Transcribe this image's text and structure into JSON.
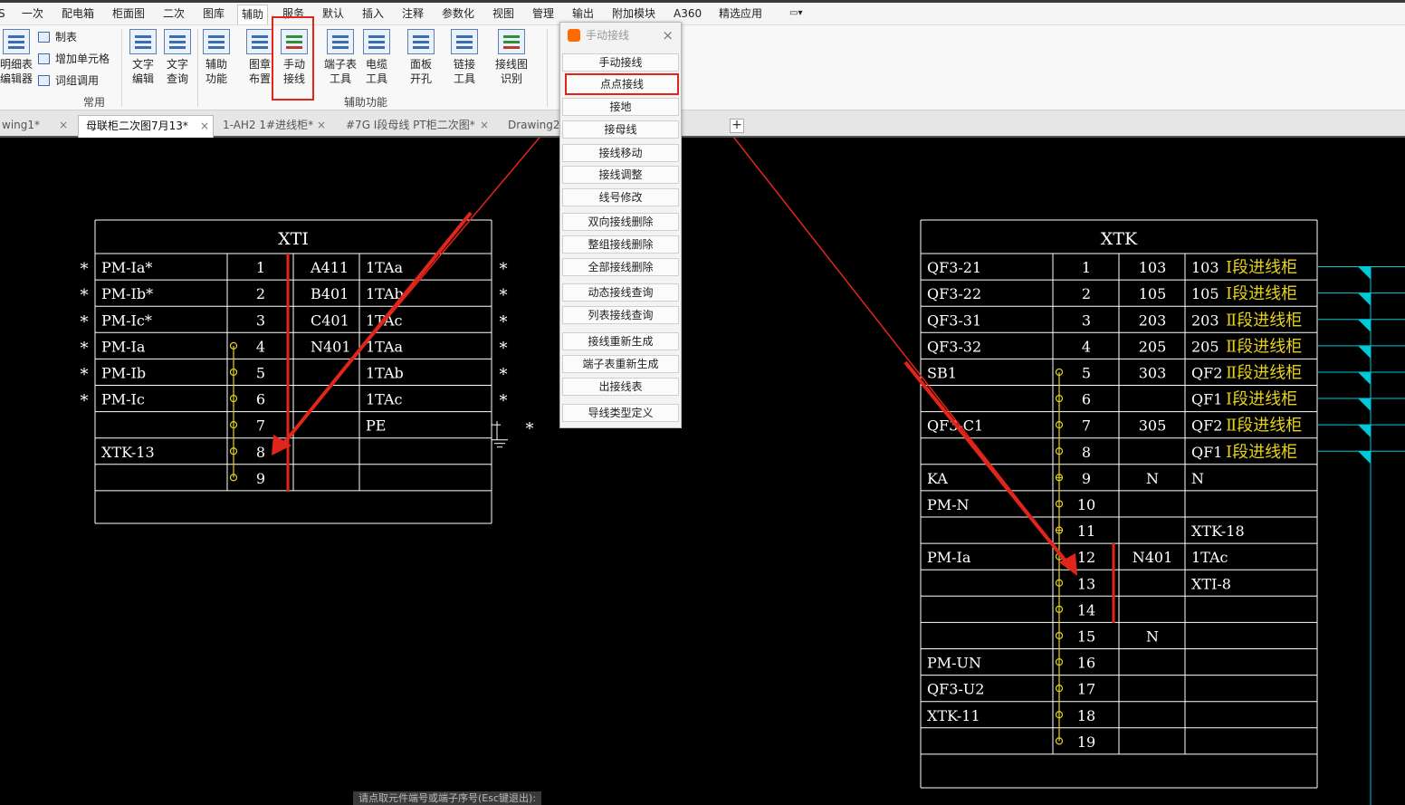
{
  "menu": {
    "tabs": [
      "S",
      "一次",
      "配电箱",
      "柜面图",
      "二次",
      "图库",
      "辅助",
      "服务",
      "默认",
      "插入",
      "注释",
      "参数化",
      "视图",
      "管理",
      "输出",
      "附加模块",
      "A360",
      "精选应用"
    ],
    "active": "辅助",
    "extra": "▭▾"
  },
  "ribbon": {
    "left_items": [
      "制表",
      "增加单元格",
      "词组调用"
    ],
    "big_left": [
      "明细表\n编辑器"
    ],
    "buttons": [
      {
        "label": "文字\n编辑"
      },
      {
        "label": "文字\n查询"
      },
      {
        "label": "辅助\n功能"
      },
      {
        "label": "图章\n布置"
      },
      {
        "label": "手动\n接线"
      },
      {
        "label": "端子表\n工具"
      },
      {
        "label": "电缆\n工具"
      },
      {
        "label": "面板\n开孔"
      },
      {
        "label": "链接\n工具"
      },
      {
        "label": "接线图\n识别"
      }
    ],
    "groups": [
      "常用",
      "辅助功能"
    ]
  },
  "doc_tabs": [
    "wing1*",
    "母联柜二次图7月13*",
    "1-AH2 1#进线柜*",
    "#7G I段母线 PT柜二次图*",
    "Drawing2*"
  ],
  "doc_tab_active": "母联柜二次图7月13*",
  "palette": {
    "title": "手动接线",
    "close": "×",
    "items": [
      "手动接线",
      "点点接线",
      "接地",
      "接母线",
      "接线移动",
      "接线调整",
      "线号修改",
      "双向接线删除",
      "整组接线删除",
      "全部接线删除",
      "动态接线查询",
      "列表接线查询",
      "接线重新生成",
      "端子表重新生成",
      "出接线表",
      "导线类型定义"
    ],
    "highlight": "点点接线"
  },
  "status": "请点取元件端号或端子序号(Esc键退出):",
  "colors": {
    "red": "#e1251b",
    "yellow": "#e6d21a",
    "cyan": "#00c8d8",
    "white": "#ffffff"
  },
  "xti": {
    "title": "XTI",
    "rows": [
      {
        "left": "PM-Ia*",
        "num": "1",
        "c3": "A411",
        "c4": "1TAa",
        "star": "*",
        "lstar": "*",
        "node": ""
      },
      {
        "left": "PM-Ib*",
        "num": "2",
        "c3": "B401",
        "c4": "1TAb",
        "star": "*",
        "lstar": "*",
        "node": ""
      },
      {
        "left": "PM-Ic*",
        "num": "3",
        "c3": "C401",
        "c4": "1TAc",
        "star": "*",
        "lstar": "*",
        "node": ""
      },
      {
        "left": "PM-Ia",
        "num": "4",
        "c3": "N401",
        "c4": "1TAa",
        "star": "*",
        "lstar": "*",
        "node": "o"
      },
      {
        "left": "PM-Ib",
        "num": "5",
        "c3": "",
        "c4": "1TAb",
        "star": "*",
        "lstar": "*",
        "node": "o"
      },
      {
        "left": "PM-Ic",
        "num": "6",
        "c3": "",
        "c4": "1TAc",
        "star": "*",
        "lstar": "*",
        "node": "o"
      },
      {
        "left": "",
        "num": "7",
        "c3": "",
        "c4": "PE",
        "star": "",
        "lstar": "",
        "node": "o"
      },
      {
        "left": "XTK-13",
        "num": "8",
        "c3": "",
        "c4": "",
        "star": "",
        "lstar": "",
        "node": "o"
      },
      {
        "left": "",
        "num": "9",
        "c3": "",
        "c4": "",
        "star": "",
        "lstar": "",
        "node": "o"
      }
    ],
    "pe_star": "*"
  },
  "xtk": {
    "title": "XTK",
    "rows": [
      {
        "left": "QF3-21",
        "num": "1",
        "c3": "103",
        "c4": "103",
        "note": "Ⅰ段进线柜",
        "node": "",
        "cyan": true
      },
      {
        "left": "QF3-22",
        "num": "2",
        "c3": "105",
        "c4": "105",
        "note": "Ⅰ段进线柜",
        "node": "",
        "cyan": true
      },
      {
        "left": "QF3-31",
        "num": "3",
        "c3": "203",
        "c4": "203",
        "note": "Ⅱ段进线柜",
        "node": "",
        "cyan": true
      },
      {
        "left": "QF3-32",
        "num": "4",
        "c3": "205",
        "c4": "205",
        "note": "Ⅱ段进线柜",
        "node": "",
        "cyan": true
      },
      {
        "left": "SB1",
        "num": "5",
        "c3": "303",
        "c4": "QF2",
        "note": "Ⅱ段进线柜",
        "node": "o",
        "cyan": true
      },
      {
        "left": "",
        "num": "6",
        "c3": "",
        "c4": "QF1",
        "note": "Ⅰ段进线柜",
        "node": "o",
        "cyan": true
      },
      {
        "left": "QF3-C1",
        "num": "7",
        "c3": "305",
        "c4": "QF2",
        "note": "Ⅱ段进线柜",
        "node": "o",
        "cyan": true
      },
      {
        "left": "",
        "num": "8",
        "c3": "",
        "c4": "QF1",
        "note": "Ⅰ段进线柜",
        "node": "o",
        "cyan": true
      },
      {
        "left": "KA",
        "num": "9",
        "c3": "N",
        "c4": "N",
        "note": "",
        "node": "+",
        "cyan": false
      },
      {
        "left": "PM-N",
        "num": "10",
        "c3": "",
        "c4": "",
        "note": "",
        "node": "o",
        "cyan": false
      },
      {
        "left": "",
        "num": "11",
        "c3": "",
        "c4": "XTK-18",
        "note": "",
        "node": "+",
        "cyan": false
      },
      {
        "left": "PM-Ia",
        "num": "12",
        "c3": "N401",
        "c4": "1TAc",
        "note": "",
        "node": "o",
        "cyan": false
      },
      {
        "left": "",
        "num": "13",
        "c3": "",
        "c4": "XTI-8",
        "note": "",
        "node": "o",
        "cyan": false
      },
      {
        "left": "",
        "num": "14",
        "c3": "",
        "c4": "",
        "note": "",
        "node": "o",
        "cyan": false
      },
      {
        "left": "",
        "num": "15",
        "c3": "N",
        "c4": "",
        "note": "",
        "node": "o",
        "cyan": false
      },
      {
        "left": "PM-UN",
        "num": "16",
        "c3": "",
        "c4": "",
        "note": "",
        "node": "o",
        "cyan": false
      },
      {
        "left": "QF3-U2",
        "num": "17",
        "c3": "",
        "c4": "",
        "note": "",
        "node": "o",
        "cyan": false
      },
      {
        "left": "XTK-11",
        "num": "18",
        "c3": "",
        "c4": "",
        "note": "",
        "node": "o",
        "cyan": false
      },
      {
        "left": "",
        "num": "19",
        "c3": "",
        "c4": "",
        "note": "",
        "node": "o",
        "cyan": false
      }
    ]
  }
}
